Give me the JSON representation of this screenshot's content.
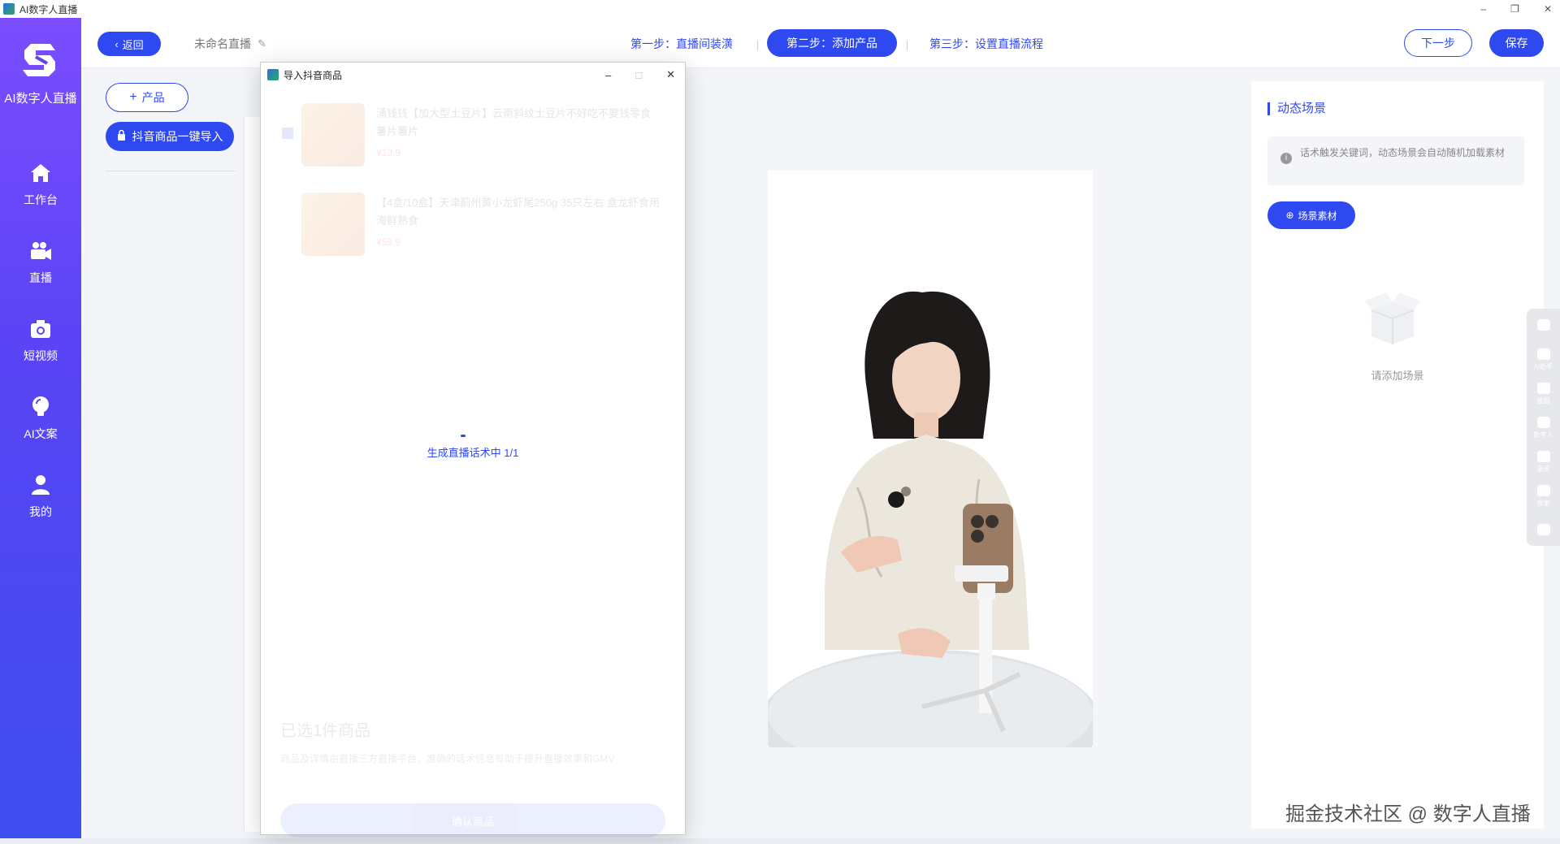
{
  "window": {
    "title": "AI数字人直播",
    "controls": [
      "–",
      "❐",
      "✕"
    ]
  },
  "sidebar": {
    "logo_text": "AI数字人直播",
    "items": [
      {
        "label": "工作台",
        "icon": "home-icon"
      },
      {
        "label": "直播",
        "icon": "video-camera-icon"
      },
      {
        "label": "短视频",
        "icon": "camera-icon"
      },
      {
        "label": "AI文案",
        "icon": "bulb-icon"
      },
      {
        "label": "我的",
        "icon": "user-icon"
      }
    ]
  },
  "topbar": {
    "back_label": "返回",
    "project_name": "未命名直播",
    "steps": [
      "第一步：直播间装潢",
      "第二步：添加产品",
      "第三步：设置直播流程"
    ],
    "active_step": 1,
    "next_label": "下一步",
    "save_label": "保存"
  },
  "left_panel": {
    "add_product_label": "产品",
    "import_label": "抖音商品一键导入"
  },
  "dialog": {
    "title": "导入抖音商品",
    "products": [
      {
        "title": "涌钱钱【加大型土豆片】云南斜纹土豆片不好吃不要钱零食薯片薯片",
        "price": "¥13.9"
      },
      {
        "title": "【4盒/10盒】天津蓟州黄小龙虾尾250g 35只左右 盒龙虾食用海鲜熟食",
        "price": "¥59.9"
      }
    ],
    "loading_text": "生成直播话术中 1/1",
    "selected_text": "已选1件商品",
    "selected_desc": "商品及详情由直播三方直播平台，准确的话术信息有助于提升直播效果和GMV",
    "confirm_label": "确认商品"
  },
  "right_panel": {
    "title": "动态场景",
    "tip": "话术触发关键词，动态场景会自动随机加载素材",
    "scene_button": "场景素材",
    "empty_text": "请添加场景"
  },
  "float_tools": [
    "AI助手",
    "截图",
    "数字人",
    "录屏",
    "搜索"
  ],
  "watermark": "掘金技术社区 @ 数字人直播",
  "colors": {
    "primary": "#2f49f0",
    "sidebar_top": "#7b4dff",
    "sidebar_bottom": "#3f4ef0",
    "workspace_bg": "#f3f5f8"
  }
}
